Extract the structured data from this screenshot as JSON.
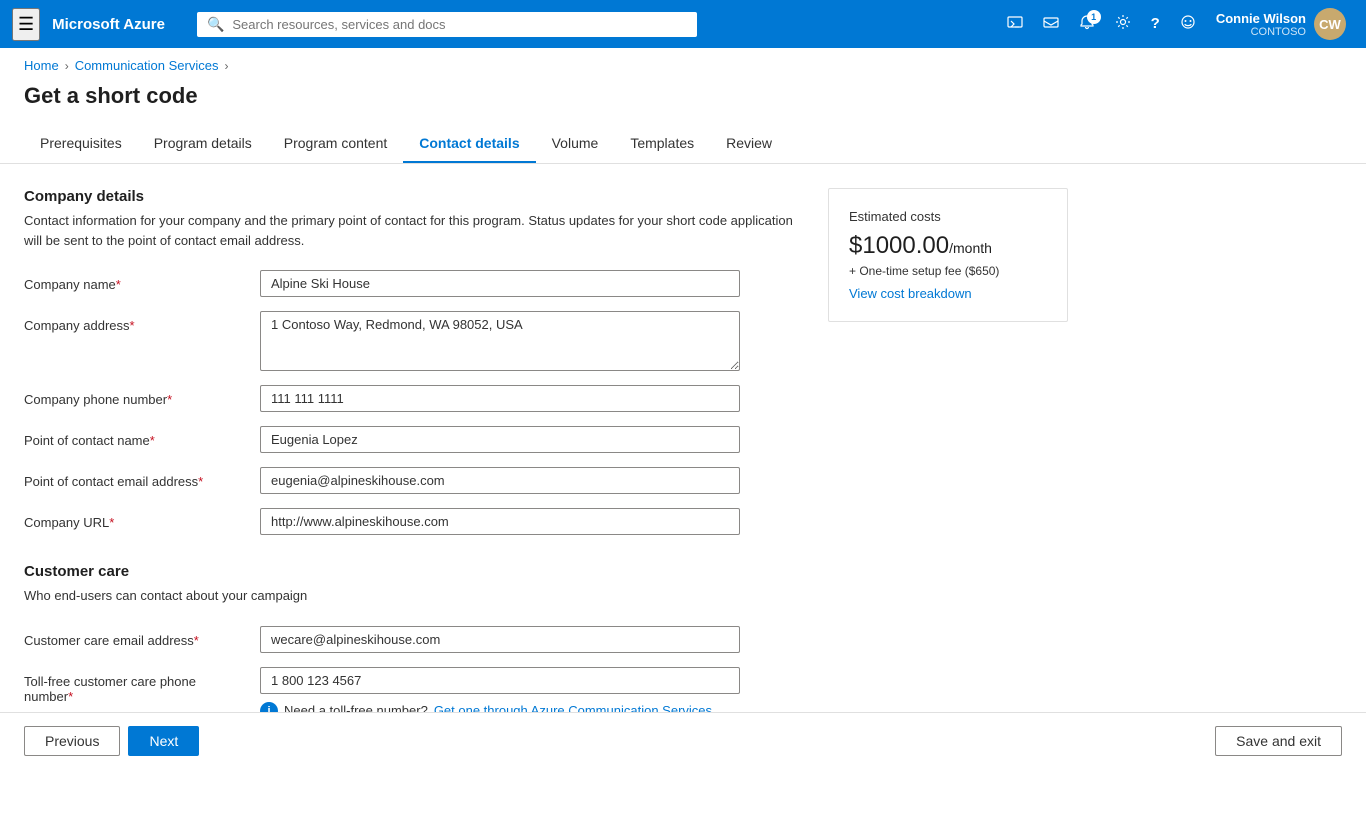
{
  "topnav": {
    "hamburger": "≡",
    "title": "Microsoft Azure",
    "search_placeholder": "Search resources, services and docs",
    "icons": [
      {
        "name": "cloud-shell-icon",
        "symbol": "⬡",
        "label": "Cloud Shell"
      },
      {
        "name": "directory-icon",
        "symbol": "⊞",
        "label": "Directory"
      },
      {
        "name": "notifications-icon",
        "symbol": "🔔",
        "label": "Notifications",
        "badge": "1"
      },
      {
        "name": "settings-icon",
        "symbol": "⚙",
        "label": "Settings"
      },
      {
        "name": "help-icon",
        "symbol": "?",
        "label": "Help"
      },
      {
        "name": "feedback-icon",
        "symbol": "☺",
        "label": "Feedback"
      }
    ],
    "user": {
      "name": "Connie Wilson",
      "org": "CONTOSO",
      "initials": "CW"
    }
  },
  "breadcrumb": {
    "items": [
      "Home",
      "Communication Services"
    ],
    "separators": [
      "›",
      "›"
    ]
  },
  "page": {
    "title": "Get a short code"
  },
  "tabs": [
    {
      "id": "prerequisites",
      "label": "Prerequisites",
      "active": false
    },
    {
      "id": "program-details",
      "label": "Program details",
      "active": false
    },
    {
      "id": "program-content",
      "label": "Program content",
      "active": false
    },
    {
      "id": "contact-details",
      "label": "Contact details",
      "active": true
    },
    {
      "id": "volume",
      "label": "Volume",
      "active": false
    },
    {
      "id": "templates",
      "label": "Templates",
      "active": false
    },
    {
      "id": "review",
      "label": "Review",
      "active": false
    }
  ],
  "company_details": {
    "section_title": "Company details",
    "section_desc": "Contact information for your company and the primary point of contact for this program. Status updates for your short code application will be sent to the point of contact email address.",
    "fields": [
      {
        "label": "Company name",
        "required": true,
        "value": "Alpine Ski House",
        "type": "text",
        "name": "company-name-input"
      },
      {
        "label": "Company address",
        "required": true,
        "value": "1 Contoso Way, Redmond, WA 98052, USA",
        "type": "textarea",
        "name": "company-address-input"
      },
      {
        "label": "Company phone number",
        "required": true,
        "value": "111 111 1111",
        "type": "text",
        "name": "company-phone-input"
      },
      {
        "label": "Point of contact name",
        "required": true,
        "value": "Eugenia Lopez",
        "type": "text",
        "name": "poc-name-input"
      },
      {
        "label": "Point of contact email address",
        "required": true,
        "value": "eugenia@alpineskihouse.com",
        "type": "text",
        "name": "poc-email-input"
      },
      {
        "label": "Company URL",
        "required": true,
        "value": "http://www.alpineskihouse.com",
        "type": "text",
        "name": "company-url-input"
      }
    ]
  },
  "customer_care": {
    "section_title": "Customer care",
    "section_desc": "Who end-users can contact about your campaign",
    "fields": [
      {
        "label": "Customer care email address",
        "required": true,
        "value": "wecare@alpineskihouse.com",
        "type": "text",
        "name": "care-email-input"
      },
      {
        "label": "Toll-free customer care phone number",
        "required": true,
        "value": "1 800 123 4567",
        "type": "text",
        "name": "care-phone-input"
      }
    ],
    "info_text": "Need a toll-free number?",
    "info_link_text": "Get one through Azure Communication Services",
    "info_link": "#"
  },
  "cost_panel": {
    "title": "Estimated costs",
    "amount": "$1000.00",
    "period": "/month",
    "setup_fee": "+ One-time setup fee ($650)",
    "breakdown_link": "View cost breakdown"
  },
  "toolbar": {
    "previous_label": "Previous",
    "next_label": "Next",
    "save_exit_label": "Save and exit"
  }
}
